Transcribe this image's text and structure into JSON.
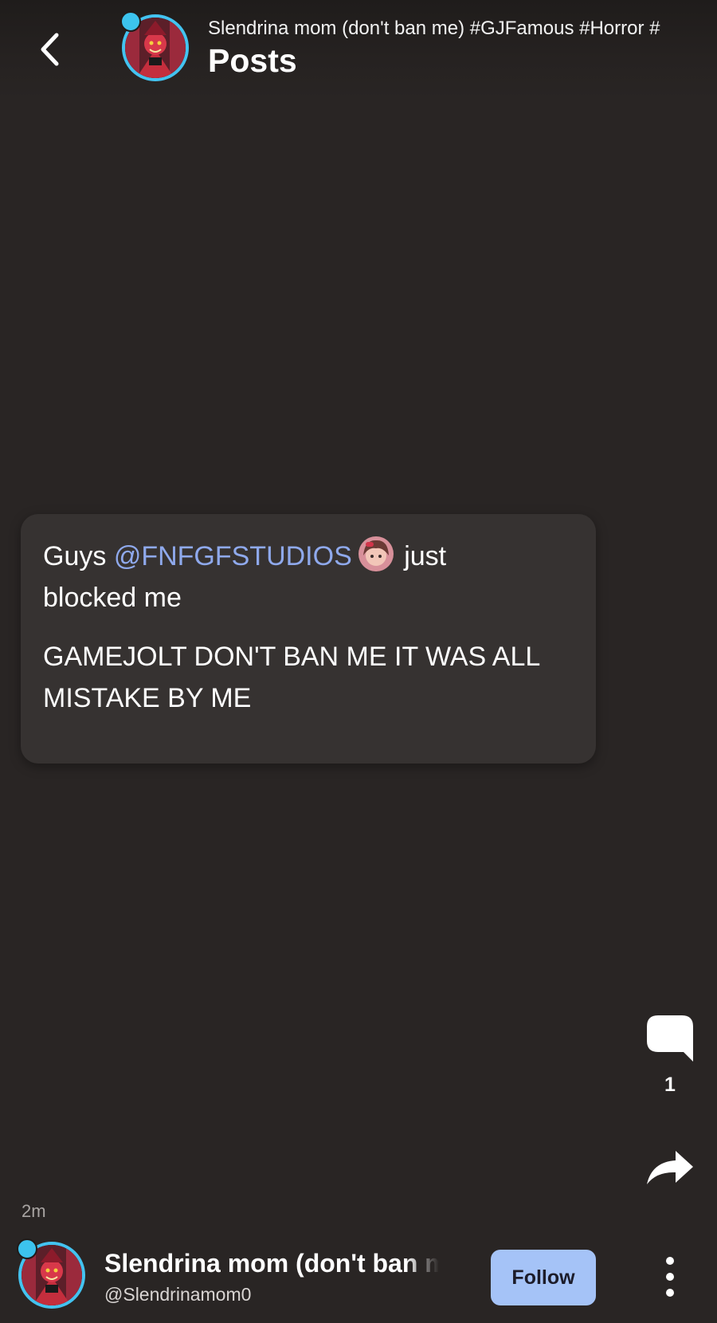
{
  "header": {
    "subtitle": "Slendrina mom (don't ban me) #GJFamous #Horror #",
    "title": "Posts"
  },
  "post": {
    "text_prefix": "Guys ",
    "mention": "@FNFGFSTUDIOS",
    "text_suffix": " just blocked me",
    "body": "GAMEJOLT DON'T BAN ME IT WAS ALL MISTAKE BY ME"
  },
  "actions": {
    "comment_count": "1"
  },
  "footer": {
    "timestamp": "2m",
    "author_name": "Slendrina mom (don't ban me)",
    "author_handle": "@Slendrinamom0",
    "follow_label": "Follow"
  },
  "colors": {
    "background": "#292524",
    "card": "#363231",
    "mention": "#8fa9ec",
    "follow_button": "#a5c3f7",
    "avatar_ring": "#43c3f0"
  },
  "icons": [
    "back-arrow-icon",
    "comment-icon",
    "share-icon",
    "more-vertical-icon"
  ]
}
